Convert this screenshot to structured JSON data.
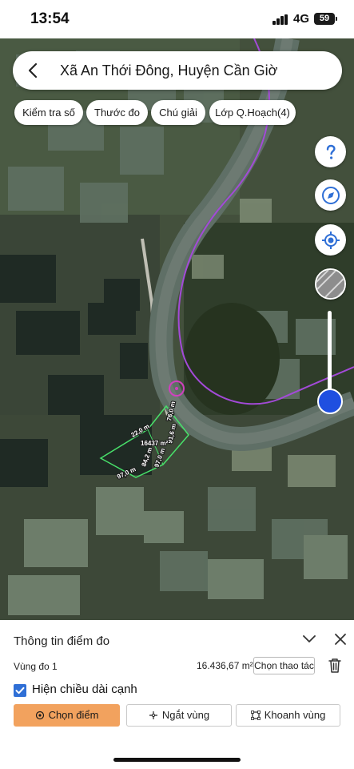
{
  "status_bar": {
    "time": "13:54",
    "network": "4G",
    "battery": "59"
  },
  "search": {
    "title": "Xã An Thới Đông, Huyện Cần Giờ"
  },
  "chips": [
    {
      "label": "Kiểm tra số"
    },
    {
      "label": "Thước đo"
    },
    {
      "label": "Chú giải"
    },
    {
      "label": "Lớp Q.Hoạch(4)"
    }
  ],
  "map": {
    "labels": {
      "edge_1": "22,0 m",
      "edge_2": "76,0 m",
      "edge_3": "91,6 m",
      "edge_4": "97,0 m",
      "area": "16437 m²",
      "inner_1": "84,2 m",
      "inner_2": "97,0 m"
    },
    "colors": {
      "boundary": "#a34ad8",
      "plot": "#48e06a"
    },
    "icons": [
      "help-icon",
      "compass-icon",
      "locate-icon",
      "layers-icon"
    ],
    "zoom_level": 0.85
  },
  "panel": {
    "title": "Thông tin điểm đo",
    "area_label": "Vùng đo 1",
    "area_value": "16.436,67 m²",
    "action_label": "Chọn thao tác",
    "show_edges_label": "Hiện chiều dài cạnh",
    "show_edges_checked": true,
    "buttons": {
      "select_point": "Chọn điểm",
      "split_area": "Ngắt vùng",
      "frame_area": "Khoanh vùng"
    },
    "accent_color": "#f2a25e",
    "checkbox_color": "#2f6fd6"
  }
}
